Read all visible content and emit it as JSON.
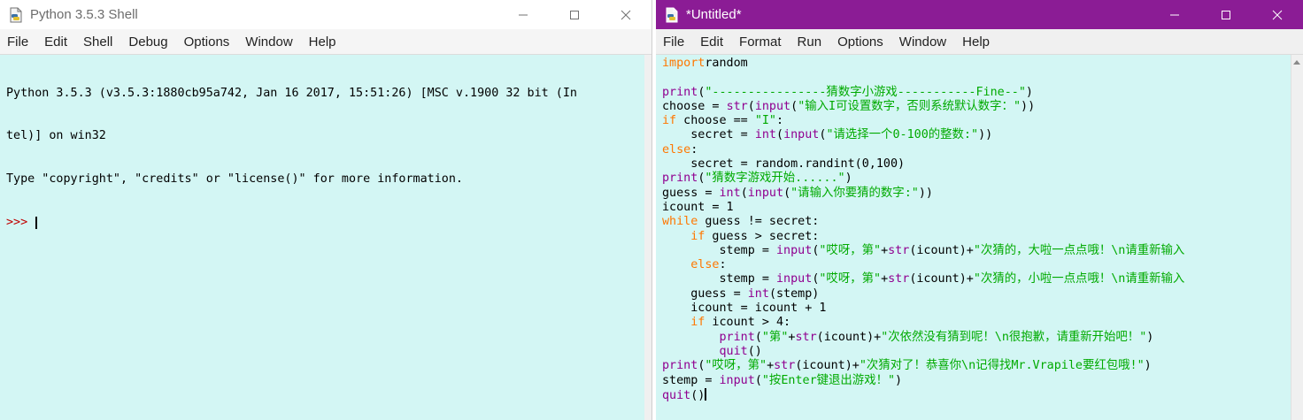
{
  "shell": {
    "title": "Python 3.5.3 Shell",
    "menu": [
      "File",
      "Edit",
      "Shell",
      "Debug",
      "Options",
      "Window",
      "Help"
    ],
    "lines": [
      "Python 3.5.3 (v3.5.3:1880cb95a742, Jan 16 2017, 15:51:26) [MSC v.1900 32 bit (In",
      "tel)] on win32",
      "Type \"copyright\", \"credits\" or \"license()\" for more information."
    ],
    "prompt": ">>> "
  },
  "editor": {
    "title": "*Untitled*",
    "menu": [
      "File",
      "Edit",
      "Format",
      "Run",
      "Options",
      "Window",
      "Help"
    ],
    "code": [
      [
        [
          "kw",
          "import"
        ],
        [
          "",
          "random"
        ]
      ],
      [],
      [
        [
          "bi",
          "print"
        ],
        [
          "",
          "("
        ],
        [
          "str",
          "\"----------------猜数字小游戏-----------Fine--\""
        ],
        [
          "",
          ")"
        ]
      ],
      [
        [
          "",
          "choose = "
        ],
        [
          "bi",
          "str"
        ],
        [
          "",
          "("
        ],
        [
          "bi",
          "input"
        ],
        [
          "",
          "("
        ],
        [
          "str",
          "\"输入I可设置数字，否则系统默认数字：\""
        ],
        [
          "",
          "))"
        ]
      ],
      [
        [
          "kw",
          "if"
        ],
        [
          "",
          " choose == "
        ],
        [
          "str",
          "\"I\""
        ],
        [
          "",
          ":"
        ]
      ],
      [
        [
          "",
          "    secret = "
        ],
        [
          "bi",
          "int"
        ],
        [
          "",
          "("
        ],
        [
          "bi",
          "input"
        ],
        [
          "",
          "("
        ],
        [
          "str",
          "\"请选择一个0-100的整数:\""
        ],
        [
          "",
          "))"
        ]
      ],
      [
        [
          "kw",
          "else"
        ],
        [
          "",
          ":"
        ]
      ],
      [
        [
          "",
          "    secret = random.randint(0,100)"
        ]
      ],
      [
        [
          "bi",
          "print"
        ],
        [
          "",
          "("
        ],
        [
          "str",
          "\"猜数字游戏开始......\""
        ],
        [
          "",
          ")"
        ]
      ],
      [
        [
          "",
          "guess = "
        ],
        [
          "bi",
          "int"
        ],
        [
          "",
          "("
        ],
        [
          "bi",
          "input"
        ],
        [
          "",
          "("
        ],
        [
          "str",
          "\"请输入你要猜的数字:\""
        ],
        [
          "",
          "))"
        ]
      ],
      [
        [
          "",
          "icount = 1"
        ]
      ],
      [
        [
          "kw",
          "while"
        ],
        [
          "",
          " guess != secret:"
        ]
      ],
      [
        [
          "",
          "    "
        ],
        [
          "kw",
          "if"
        ],
        [
          "",
          " guess > secret:"
        ]
      ],
      [
        [
          "",
          "        stemp = "
        ],
        [
          "bi",
          "input"
        ],
        [
          "",
          "("
        ],
        [
          "str",
          "\"哎呀，第\""
        ],
        [
          "",
          "+"
        ],
        [
          "bi",
          "str"
        ],
        [
          "",
          "(icount)+"
        ],
        [
          "str",
          "\"次猜的，大啦一点点哦！\\n请重新输入"
        ]
      ],
      [
        [
          "",
          "    "
        ],
        [
          "kw",
          "else"
        ],
        [
          "",
          ":"
        ]
      ],
      [
        [
          "",
          "        stemp = "
        ],
        [
          "bi",
          "input"
        ],
        [
          "",
          "("
        ],
        [
          "str",
          "\"哎呀，第\""
        ],
        [
          "",
          "+"
        ],
        [
          "bi",
          "str"
        ],
        [
          "",
          "(icount)+"
        ],
        [
          "str",
          "\"次猜的，小啦一点点哦！\\n请重新输入"
        ]
      ],
      [
        [
          "",
          "    guess = "
        ],
        [
          "bi",
          "int"
        ],
        [
          "",
          "(stemp)"
        ]
      ],
      [
        [
          "",
          "    icount = icount + 1"
        ]
      ],
      [
        [
          "",
          "    "
        ],
        [
          "kw",
          "if"
        ],
        [
          "",
          " icount > 4:"
        ]
      ],
      [
        [
          "",
          "        "
        ],
        [
          "bi",
          "print"
        ],
        [
          "",
          "("
        ],
        [
          "str",
          "\"第\""
        ],
        [
          "",
          "+"
        ],
        [
          "bi",
          "str"
        ],
        [
          "",
          "(icount)+"
        ],
        [
          "str",
          "\"次依然没有猜到呢！\\n很抱歉，请重新开始吧！\""
        ],
        [
          "",
          ")"
        ]
      ],
      [
        [
          "",
          "        "
        ],
        [
          "bi",
          "quit"
        ],
        [
          "",
          "()"
        ]
      ],
      [
        [
          "bi",
          "print"
        ],
        [
          "",
          "("
        ],
        [
          "str",
          "\"哎呀，第\""
        ],
        [
          "",
          "+"
        ],
        [
          "bi",
          "str"
        ],
        [
          "",
          "(icount)+"
        ],
        [
          "str",
          "\"次猜对了！恭喜你\\n记得找Mr.Vrapile要红包哦!\""
        ],
        [
          "",
          ")"
        ]
      ],
      [
        [
          "",
          "stemp = "
        ],
        [
          "bi",
          "input"
        ],
        [
          "",
          "("
        ],
        [
          "str",
          "\"按Enter键退出游戏！\""
        ],
        [
          "",
          ")"
        ]
      ],
      [
        [
          "bi",
          "quit"
        ],
        [
          "",
          "()"
        ]
      ]
    ]
  },
  "icons": {
    "app": "python-idle-icon",
    "minimize": "minimize-icon",
    "maximize": "maximize-icon",
    "close": "close-icon"
  },
  "colors": {
    "editor_titlebar": "#8b1c95",
    "text_background": "#d3f6f4",
    "keyword": "#ff7700",
    "builtin": "#900090",
    "string": "#00aa00",
    "prompt": "#c00000"
  }
}
